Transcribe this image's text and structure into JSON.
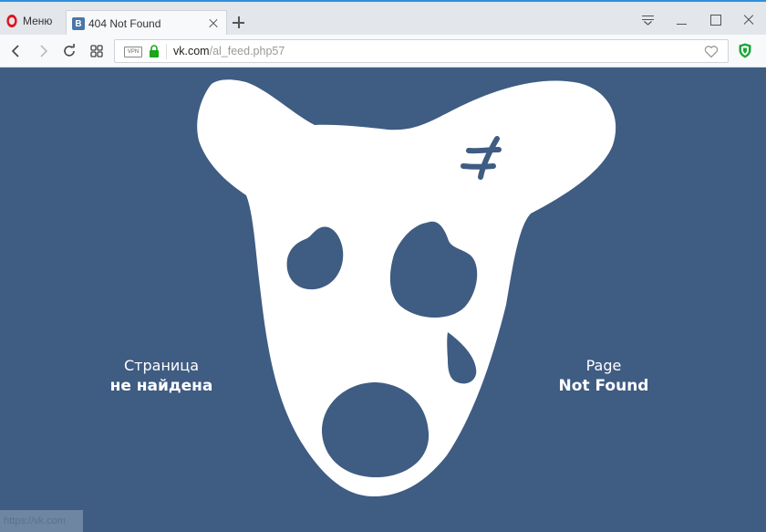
{
  "browser": {
    "menu_label": "Меню",
    "tab": {
      "title": "404 Not Found",
      "favicon_letter": "В"
    },
    "address": {
      "vpn_label": "VPN",
      "url_host": "vk.com",
      "url_path": "/al_feed.php57"
    },
    "status_url": "https://vk.com"
  },
  "page": {
    "message_ru": {
      "line1": "Страница",
      "line2": "не найдена"
    },
    "message_en": {
      "line1": "Page",
      "line2": "Not Found"
    }
  },
  "colors": {
    "page_background": "#3f5c82",
    "dog": "#ffffff",
    "opera_red": "#e0141e",
    "vk_brand": "#4a76a8",
    "secure_green": "#1aa51a"
  }
}
